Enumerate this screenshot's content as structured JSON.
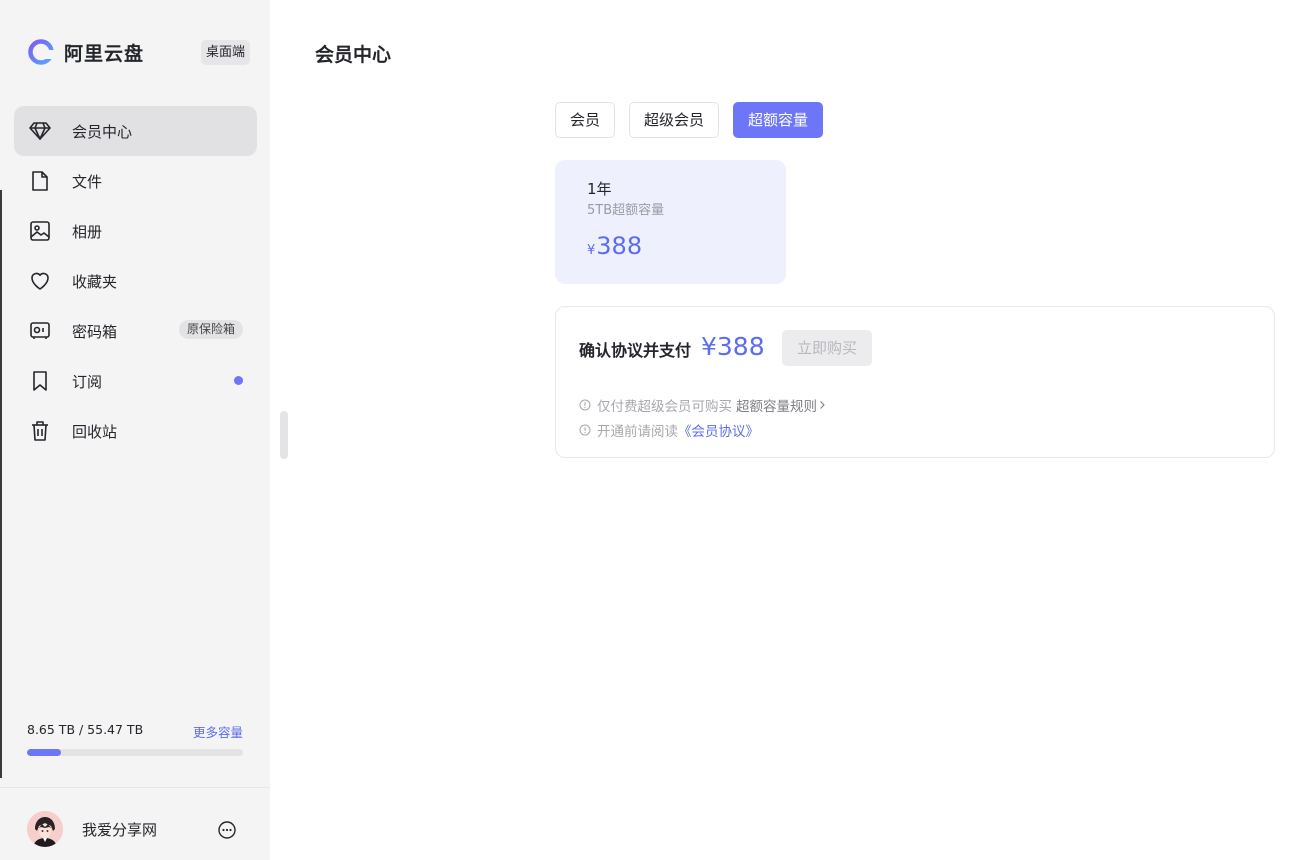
{
  "app": {
    "name": "阿里云盘",
    "platform_badge": "桌面端"
  },
  "sidebar": {
    "items": [
      {
        "label": "会员中心",
        "icon": "diamond-icon",
        "active": true
      },
      {
        "label": "文件",
        "icon": "file-icon"
      },
      {
        "label": "相册",
        "icon": "photo-icon"
      },
      {
        "label": "收藏夹",
        "icon": "heart-icon"
      },
      {
        "label": "密码箱",
        "icon": "safe-icon",
        "badge": "原保险箱"
      },
      {
        "label": "订阅",
        "icon": "bookmark-icon",
        "dot": true
      },
      {
        "label": "回收站",
        "icon": "trash-icon"
      }
    ],
    "storage": {
      "used_text": "8.65 TB / 55.47 TB",
      "more_label": "更多容量",
      "fraction": 0.156
    },
    "user": {
      "name": "我爱分享网"
    }
  },
  "main": {
    "title": "会员中心",
    "tabs": [
      {
        "label": "会员"
      },
      {
        "label": "超级会员"
      },
      {
        "label": "超额容量",
        "active": true
      }
    ],
    "plan": {
      "duration": "1年",
      "desc": "5TB超额容量",
      "currency": "¥",
      "price": "388"
    },
    "pay": {
      "label": "确认协议并支付",
      "amount": "¥388",
      "button": "立即购买",
      "note1": "仅付费超级会员可购买",
      "note1_link": "超额容量规则",
      "note2": "开通前请阅读",
      "note2_link": "《会员协议》"
    }
  },
  "colors": {
    "accent": "#6c76f7",
    "accent_text": "#5b6cf0",
    "sidebar_bg": "#f4f4f5",
    "card_bg": "#eef0fd"
  }
}
